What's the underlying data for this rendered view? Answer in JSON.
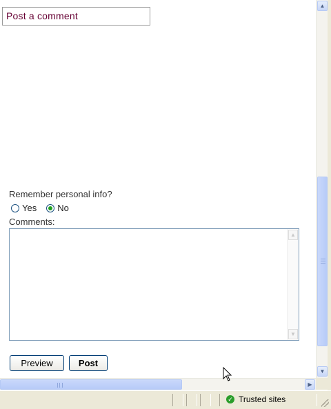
{
  "heading": "Post a comment",
  "form": {
    "remember_label": "Remember personal info?",
    "options": [
      "Yes",
      "No"
    ],
    "selected": "No",
    "comments_label": "Comments:",
    "comments_value": ""
  },
  "buttons": {
    "preview": "Preview",
    "post": "Post"
  },
  "statusbar": {
    "zone": "Trusted sites"
  },
  "colors": {
    "heading_text": "#660033",
    "scroll_thumb": "#c3d3fd",
    "statusbar_bg": "#ece9d8"
  },
  "icons": {
    "trusted": "trusted-sites-check-icon"
  }
}
